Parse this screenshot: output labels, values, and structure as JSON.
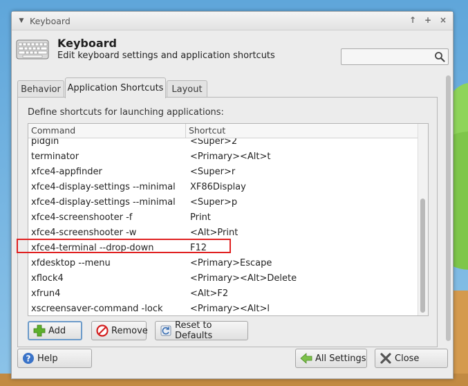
{
  "window": {
    "title": "Keyboard",
    "controls": [
      "↑",
      "+",
      "×"
    ]
  },
  "header": {
    "title": "Keyboard",
    "subtitle": "Edit keyboard settings and application shortcuts",
    "search": {
      "value": "",
      "placeholder": ""
    }
  },
  "tabs": [
    {
      "label": "Behavior",
      "active": false
    },
    {
      "label": "Application Shortcuts",
      "active": true
    },
    {
      "label": "Layout",
      "active": false
    }
  ],
  "page": {
    "intro": "Define shortcuts for launching applications:",
    "columns": {
      "command": "Command",
      "shortcut": "Shortcut"
    },
    "rows": [
      {
        "command": "pidgin",
        "shortcut": "<Super>2"
      },
      {
        "command": "terminator",
        "shortcut": "<Primary><Alt>t"
      },
      {
        "command": "xfce4-appfinder",
        "shortcut": "<Super>r"
      },
      {
        "command": "xfce4-display-settings --minimal",
        "shortcut": "XF86Display"
      },
      {
        "command": "xfce4-display-settings --minimal",
        "shortcut": "<Super>p"
      },
      {
        "command": "xfce4-screenshooter -f",
        "shortcut": "Print"
      },
      {
        "command": "xfce4-screenshooter -w",
        "shortcut": "<Alt>Print"
      },
      {
        "command": "xfce4-terminal --drop-down",
        "shortcut": "F12"
      },
      {
        "command": "xfdesktop --menu",
        "shortcut": "<Primary>Escape"
      },
      {
        "command": "xflock4",
        "shortcut": "<Primary><Alt>Delete"
      },
      {
        "command": "xfrun4",
        "shortcut": "<Alt>F2"
      },
      {
        "command": "xscreensaver-command -lock",
        "shortcut": "<Primary><Alt>l"
      }
    ],
    "buttons": {
      "add": "Add",
      "remove": "Remove",
      "reset": "Reset to Defaults"
    }
  },
  "footer": {
    "help": "Help",
    "all_settings": "All Settings",
    "close": "Close"
  },
  "colors": {
    "highlight": "#e02020",
    "add_icon": "#5cb02c",
    "remove_icon": "#d42020",
    "help_icon": "#3a73c8"
  }
}
